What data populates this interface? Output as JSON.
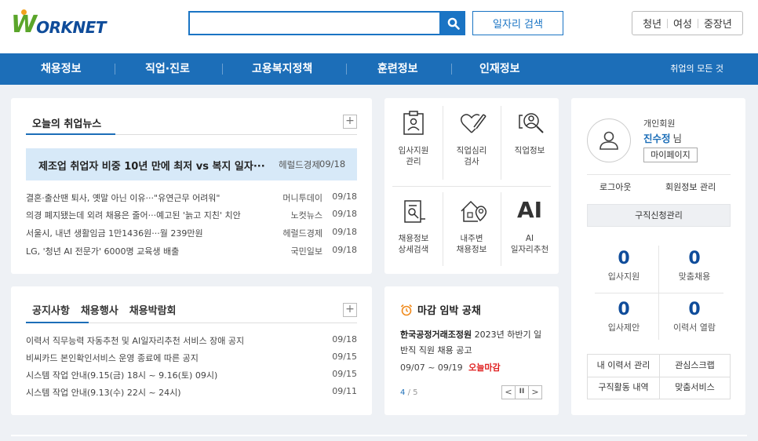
{
  "header": {
    "logo_w": "W",
    "logo_text": "ORKNET",
    "search": {
      "value": "",
      "placeholder": ""
    },
    "job_search_label": "일자리 검색",
    "target_groups": [
      "청년",
      "여성",
      "중장년"
    ]
  },
  "nav": {
    "items": [
      "채용정보",
      "직업·진로",
      "고용복지정책",
      "훈련정보",
      "인재정보"
    ],
    "right_link": "취업의 모든 것"
  },
  "news": {
    "title": "오늘의 취업뉴스",
    "headline": {
      "title": "제조업 취업자 비중 10년 만에 최저 vs 복지 일자···",
      "source": "헤럴드경제",
      "date": "09/18"
    },
    "items": [
      {
        "title": "결혼·출산땐 퇴사, 옛말 아닌 이유···\"유연근무 어려워\"",
        "source": "머니투데이",
        "date": "09/18"
      },
      {
        "title": "의경 폐지됐는데 외려 채용은 줄어···예고된 '늙고 지친' 치안",
        "source": "노컷뉴스",
        "date": "09/18"
      },
      {
        "title": "서울시, 내년 생활임금 1만1436원···월 239만원",
        "source": "헤럴드경제",
        "date": "09/18"
      },
      {
        "title": "LG, '청년 AI 전문가' 6000명 교육생 배출",
        "source": "국민일보",
        "date": "09/18"
      }
    ]
  },
  "notice": {
    "tabs": [
      "공지사항",
      "채용행사",
      "채용박람회"
    ],
    "items": [
      {
        "title": "이력서 직무능력 자동추천 및 AI일자리추천 서비스 장애 공지",
        "date": "09/18"
      },
      {
        "title": "비씨카드 본인확인서비스 운영 종료에 따른 공지",
        "date": "09/15"
      },
      {
        "title": "시스템 작업 안내(9.15(금) 18시 ~ 9.16(토) 09시)",
        "date": "09/15"
      },
      {
        "title": "시스템 작업 안내(9.13(수) 22시 ~ 24시)",
        "date": "09/11"
      }
    ]
  },
  "services": {
    "items": [
      {
        "label": "입사지원\n관리",
        "icon": "clipboard-person-icon"
      },
      {
        "label": "직업심리\n검사",
        "icon": "heart-pencil-icon"
      },
      {
        "label": "직업정보",
        "icon": "magnifier-person-icon"
      },
      {
        "label": "채용정보\n상세검색",
        "icon": "document-search-icon"
      },
      {
        "label": "내주변\n채용정보",
        "icon": "house-location-icon"
      },
      {
        "label": "AI\n일자리추천",
        "icon": "ai-text-icon"
      }
    ],
    "ai_text": "AI"
  },
  "deadline": {
    "title": "마감 임박 공채",
    "org": "한국공정거래조정원",
    "desc": "2023년 하반기 일반직 직원 채용 공고",
    "period": "09/07 ~ 09/19",
    "status": "오늘마감",
    "page_current": "4",
    "page_total": "/ 5",
    "pager_prev": "<",
    "pager_pause": "II",
    "pager_next": ">"
  },
  "profile": {
    "member_type": "개인회원",
    "name": "진수정",
    "name_suffix": "님",
    "mypage_label": "마이페이지",
    "logout_label": "로그아웃",
    "info_label": "회원정보 관리",
    "jobreq_label": "구직신청관리",
    "stats": [
      {
        "value": "0",
        "label": "입사지원"
      },
      {
        "value": "0",
        "label": "맞춤채용"
      },
      {
        "value": "0",
        "label": "입사제안"
      },
      {
        "value": "0",
        "label": "이력서 열람"
      }
    ],
    "quick": [
      "내 이력서 관리",
      "관심스크랩",
      "구직활동 내역",
      "맞춤서비스"
    ]
  },
  "colors": {
    "brand_blue": "#1c6eb8",
    "accent_green": "#5aa52a",
    "deadline_red": "#e02020"
  }
}
